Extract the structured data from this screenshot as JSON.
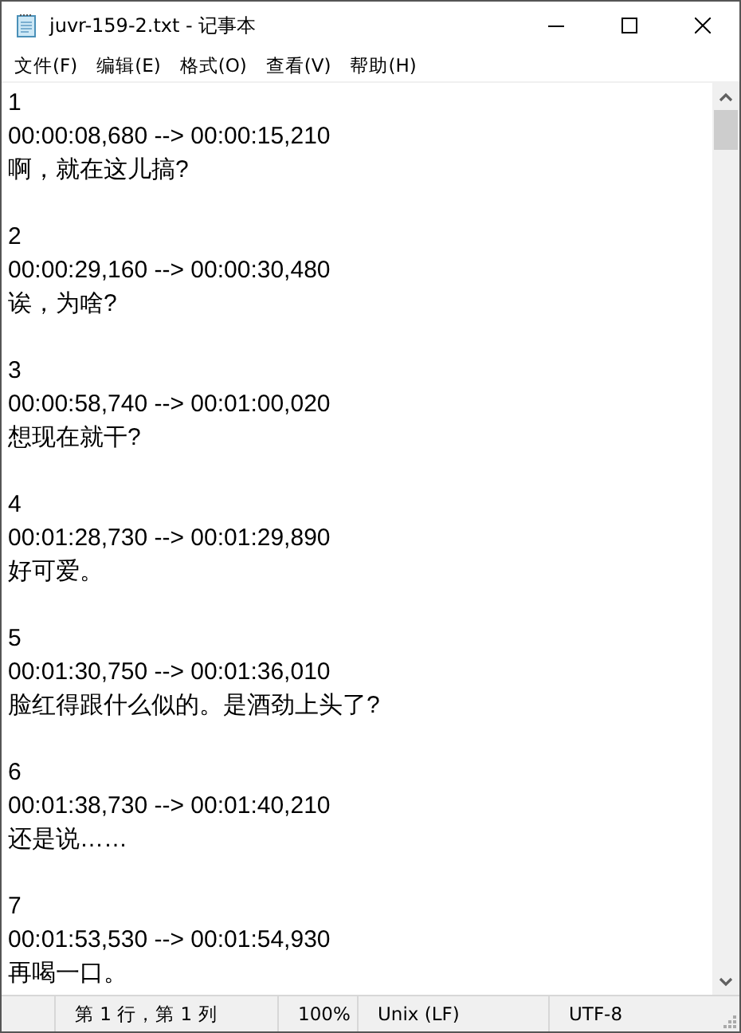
{
  "window": {
    "title": "juvr-159-2.txt - 记事本"
  },
  "menu": [
    "文件(F)",
    "编辑(E)",
    "格式(O)",
    "查看(V)",
    "帮助(H)"
  ],
  "entries": [
    {
      "index": "1",
      "time": "00:00:08,680 --> 00:00:15,210",
      "text": "啊，就在这儿搞?"
    },
    {
      "index": "2",
      "time": "00:00:29,160 --> 00:00:30,480",
      "text": "诶，为啥?"
    },
    {
      "index": "3",
      "time": "00:00:58,740 --> 00:01:00,020",
      "text": "想现在就干?"
    },
    {
      "index": "4",
      "time": "00:01:28,730 --> 00:01:29,890",
      "text": "好可爱。"
    },
    {
      "index": "5",
      "time": "00:01:30,750 --> 00:01:36,010",
      "text": "脸红得跟什么似的。是酒劲上头了?"
    },
    {
      "index": "6",
      "time": "00:01:38,730 --> 00:01:40,210",
      "text": "还是说……"
    },
    {
      "index": "7",
      "time": "00:01:53,530 --> 00:01:54,930",
      "text": "再喝一口。"
    }
  ],
  "status_bar": {
    "position": "第 1 行，第 1 列",
    "zoom": "100%",
    "line_ending": "Unix (LF)",
    "encoding": "UTF-8"
  }
}
